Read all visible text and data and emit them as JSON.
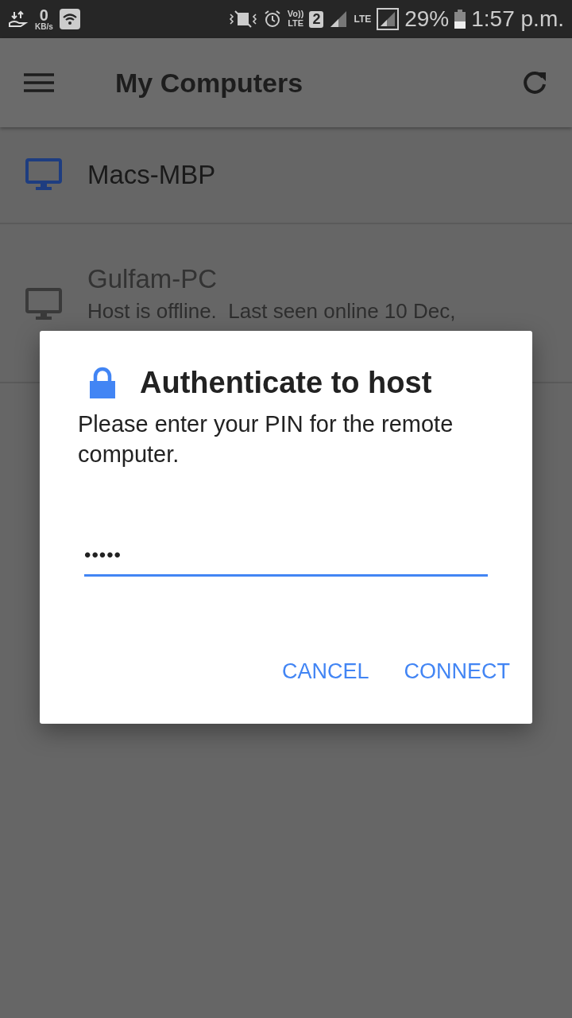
{
  "status_bar": {
    "speed_value": "0",
    "speed_unit": "KB/s",
    "volte_top": "Vo))",
    "volte_bottom": "LTE",
    "sim": "2",
    "network": "LTE",
    "battery": "29%",
    "time": "1:57 p.m."
  },
  "app_bar": {
    "title": "My Computers"
  },
  "computers": [
    {
      "name": "Macs-MBP",
      "online": true
    },
    {
      "name": "Gulfam-PC",
      "online": false,
      "status": "Host is offline.  Last seen online 10 Dec,"
    }
  ],
  "dialog": {
    "title": "Authenticate to host",
    "message": "Please enter your PIN for the remote computer.",
    "pin": "•••••",
    "buttons": [
      "CANCEL",
      "CONNECT"
    ]
  }
}
